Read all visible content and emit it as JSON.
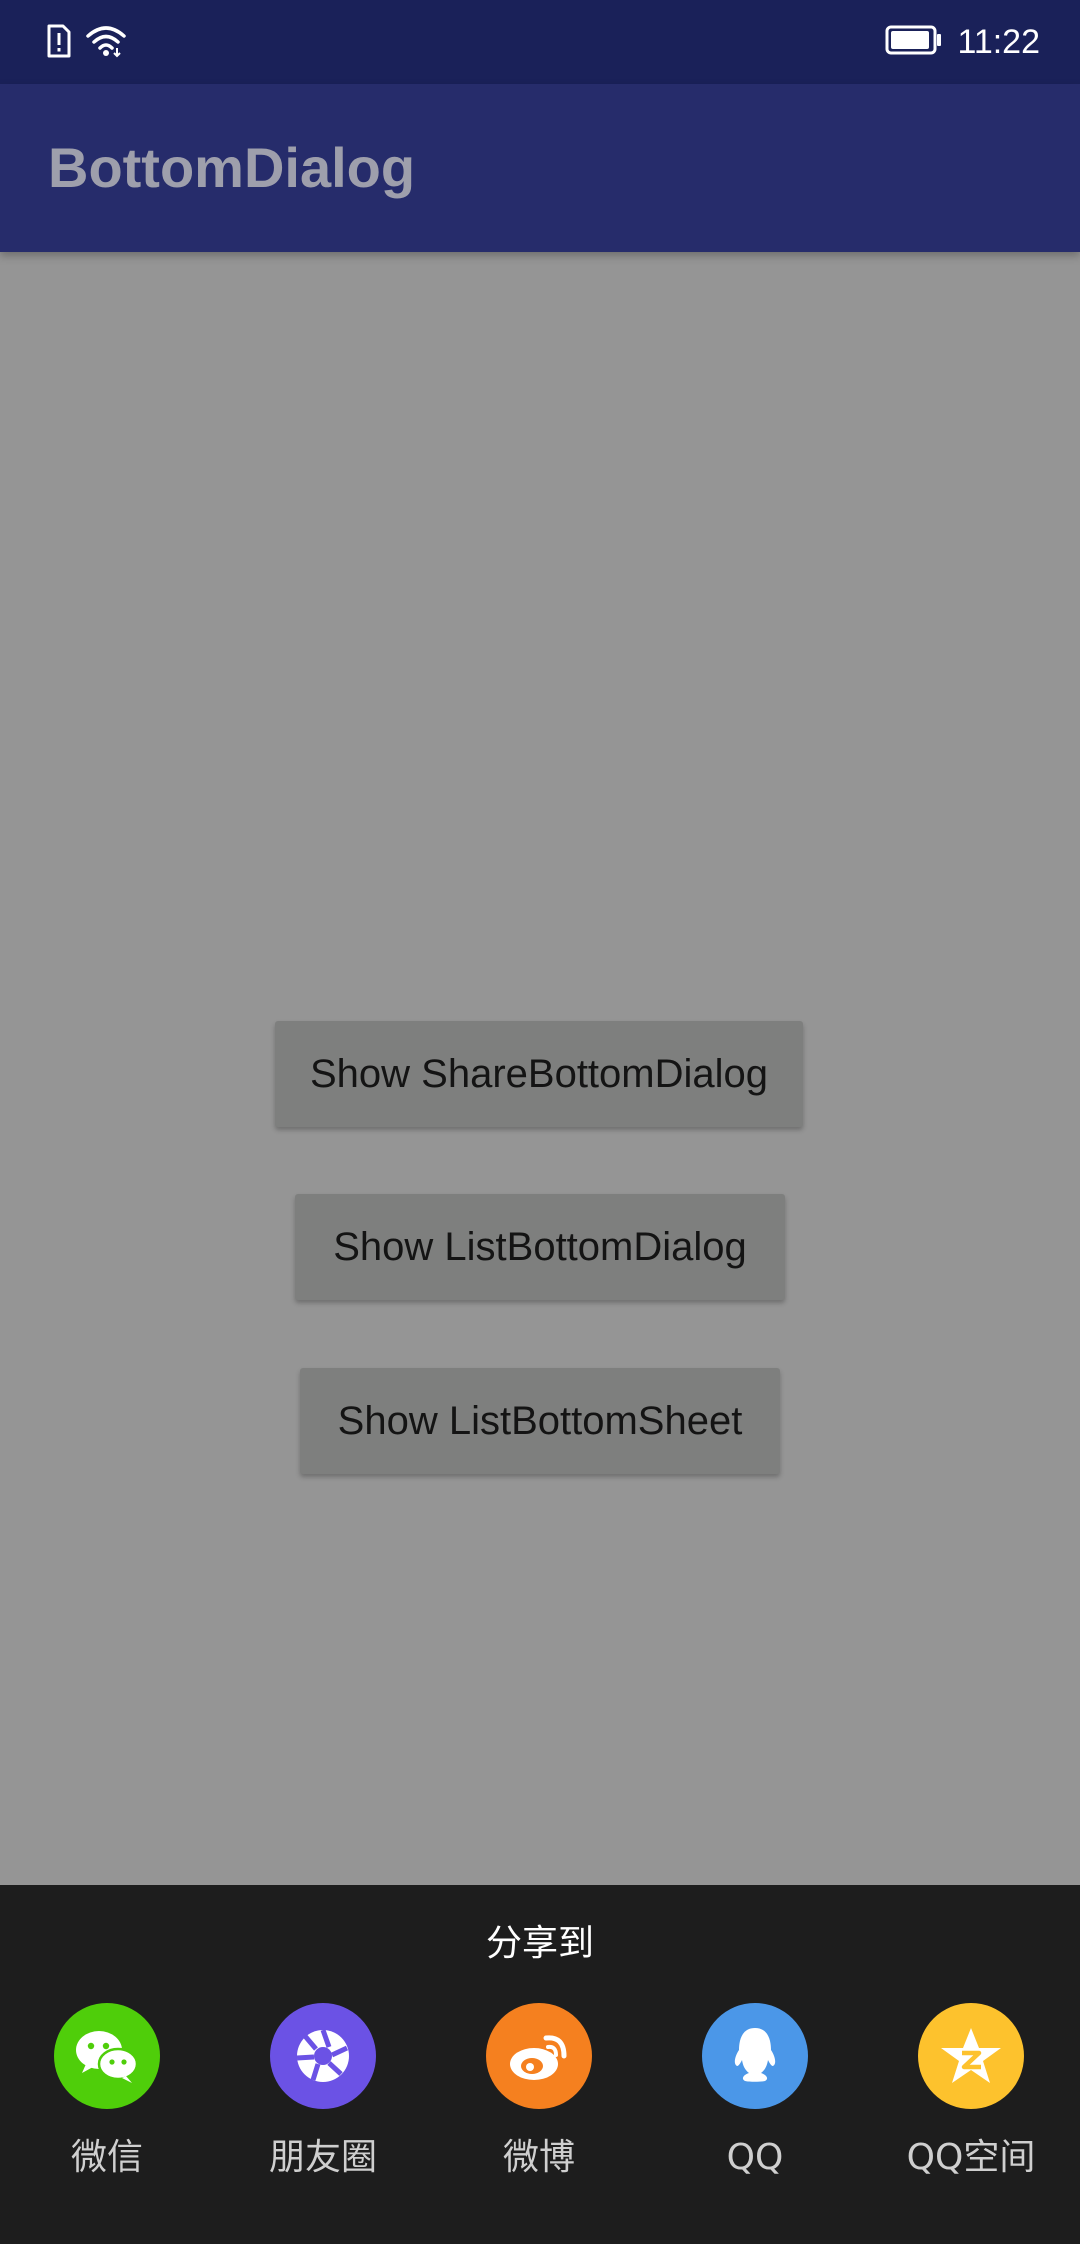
{
  "status_bar": {
    "time": "11:22",
    "icons": [
      "sim-alert-icon",
      "wifi-icon",
      "battery-icon"
    ]
  },
  "app_bar": {
    "title": "BottomDialog"
  },
  "buttons": {
    "share_dialog": "Show ShareBottomDialog",
    "list_dialog": "Show ListBottomDialog",
    "list_sheet": "Show ListBottomSheet"
  },
  "share_dialog": {
    "title": "分享到",
    "items": [
      {
        "label": "微信",
        "icon": "wechat-icon",
        "color": "#4fce0a"
      },
      {
        "label": "朋友圈",
        "icon": "moments-icon",
        "color": "#6b52e5"
      },
      {
        "label": "微博",
        "icon": "weibo-icon",
        "color": "#f5801f"
      },
      {
        "label": "QQ",
        "icon": "qq-icon",
        "color": "#4b97e8"
      },
      {
        "label": "QQ空间",
        "icon": "qzone-icon",
        "color": "#fdc22d"
      }
    ]
  },
  "colors": {
    "status_bar": "#1a2159",
    "app_bar": "#262c6b",
    "background": "#959595",
    "button": "#7e7f7e",
    "dialog": "#1d1d1d"
  }
}
